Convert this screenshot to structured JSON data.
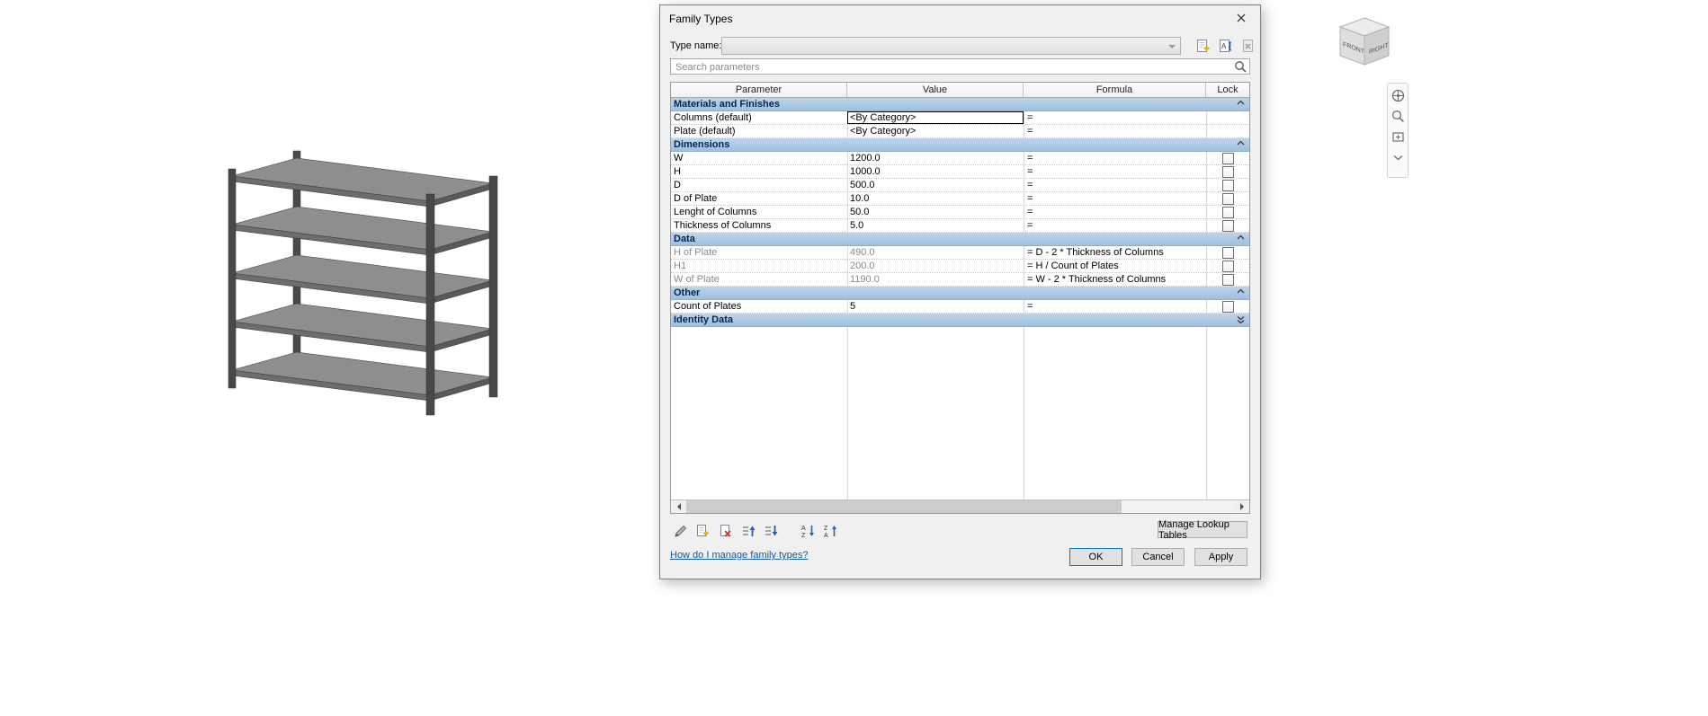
{
  "window": {
    "title": "Family Types"
  },
  "type_name": {
    "label": "Type name:",
    "value": ""
  },
  "search": {
    "placeholder": "Search parameters"
  },
  "table": {
    "headers": [
      "Parameter",
      "Value",
      "Formula",
      "Lock"
    ],
    "sections": [
      {
        "name": "Materials and Finishes",
        "collapsed": false,
        "rows": [
          {
            "parameter": "Columns (default)",
            "value": "<By Category>",
            "formula": "=",
            "lock": null,
            "selected": true
          },
          {
            "parameter": "Plate (default)",
            "value": "<By Category>",
            "formula": "=",
            "lock": null
          }
        ]
      },
      {
        "name": "Dimensions",
        "collapsed": false,
        "rows": [
          {
            "parameter": "W",
            "value": "1200.0",
            "formula": "=",
            "lock": false
          },
          {
            "parameter": "H",
            "value": "1000.0",
            "formula": "=",
            "lock": false
          },
          {
            "parameter": "D",
            "value": "500.0",
            "formula": "=",
            "lock": false
          },
          {
            "parameter": "D of Plate",
            "value": "10.0",
            "formula": "=",
            "lock": false
          },
          {
            "parameter": "Lenght of Columns",
            "value": "50.0",
            "formula": "=",
            "lock": false
          },
          {
            "parameter": "Thickness of Columns",
            "value": "5.0",
            "formula": "=",
            "lock": false
          }
        ]
      },
      {
        "name": "Data",
        "collapsed": false,
        "rows": [
          {
            "parameter": "H of Plate",
            "value": "490.0",
            "formula": "= D - 2 * Thickness of Columns",
            "lock": false,
            "disabled": true
          },
          {
            "parameter": "H1",
            "value": "200.0",
            "formula": "= H / Count of Plates",
            "lock": false,
            "disabled": true
          },
          {
            "parameter": "W of Plate",
            "value": "1190.0",
            "formula": "= W - 2 * Thickness of Columns",
            "lock": false,
            "disabled": true
          }
        ]
      },
      {
        "name": "Other",
        "collapsed": false,
        "rows": [
          {
            "parameter": "Count of Plates",
            "value": "5",
            "formula": "=",
            "lock": false
          }
        ]
      },
      {
        "name": "Identity Data",
        "collapsed": true,
        "rows": []
      }
    ]
  },
  "toolbar_icons": [
    "edit-parameter",
    "new-parameter",
    "delete-parameter",
    "move-up",
    "move-down",
    "sort-ascending",
    "sort-descending"
  ],
  "buttons": {
    "ok": "OK",
    "cancel": "Cancel",
    "apply": "Apply",
    "manage_lookup_tables": "Manage Lookup Tables"
  },
  "help_link": "How do I manage family types?",
  "viewcube": {
    "front": "FRONT",
    "right": "RIGHT"
  },
  "colors": {
    "section_header_blue": "#a9c6e3",
    "selection_border": "#000000",
    "default_button_border": "#0078d7",
    "link_blue": "#0b5cab"
  }
}
